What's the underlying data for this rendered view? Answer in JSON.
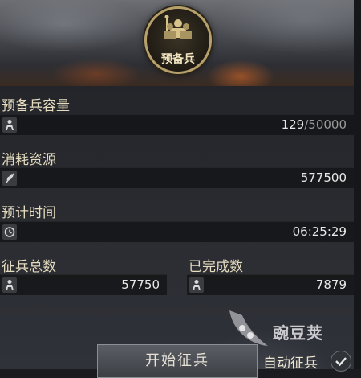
{
  "emblem": {
    "label": "预备兵",
    "icon": "soldier-icon"
  },
  "capacity": {
    "label": "预备兵容量",
    "current": "129",
    "sep": "/50000",
    "icon": "soldier-icon"
  },
  "cost": {
    "label": "消耗资源",
    "value": "577500",
    "icon": "grain-icon"
  },
  "time": {
    "label": "预计时间",
    "value": "06:25:29",
    "icon": "clock-icon"
  },
  "total": {
    "label": "征兵总数",
    "value": "57750",
    "icon": "soldier-icon"
  },
  "done": {
    "label": "已完成数",
    "value": "7879",
    "icon": "soldier-icon"
  },
  "buttons": {
    "start": "开始征兵",
    "auto": "自动征兵"
  },
  "watermark": "豌豆荚",
  "colors": {
    "green": "#8cd46a",
    "gold": "#b7a06a"
  }
}
